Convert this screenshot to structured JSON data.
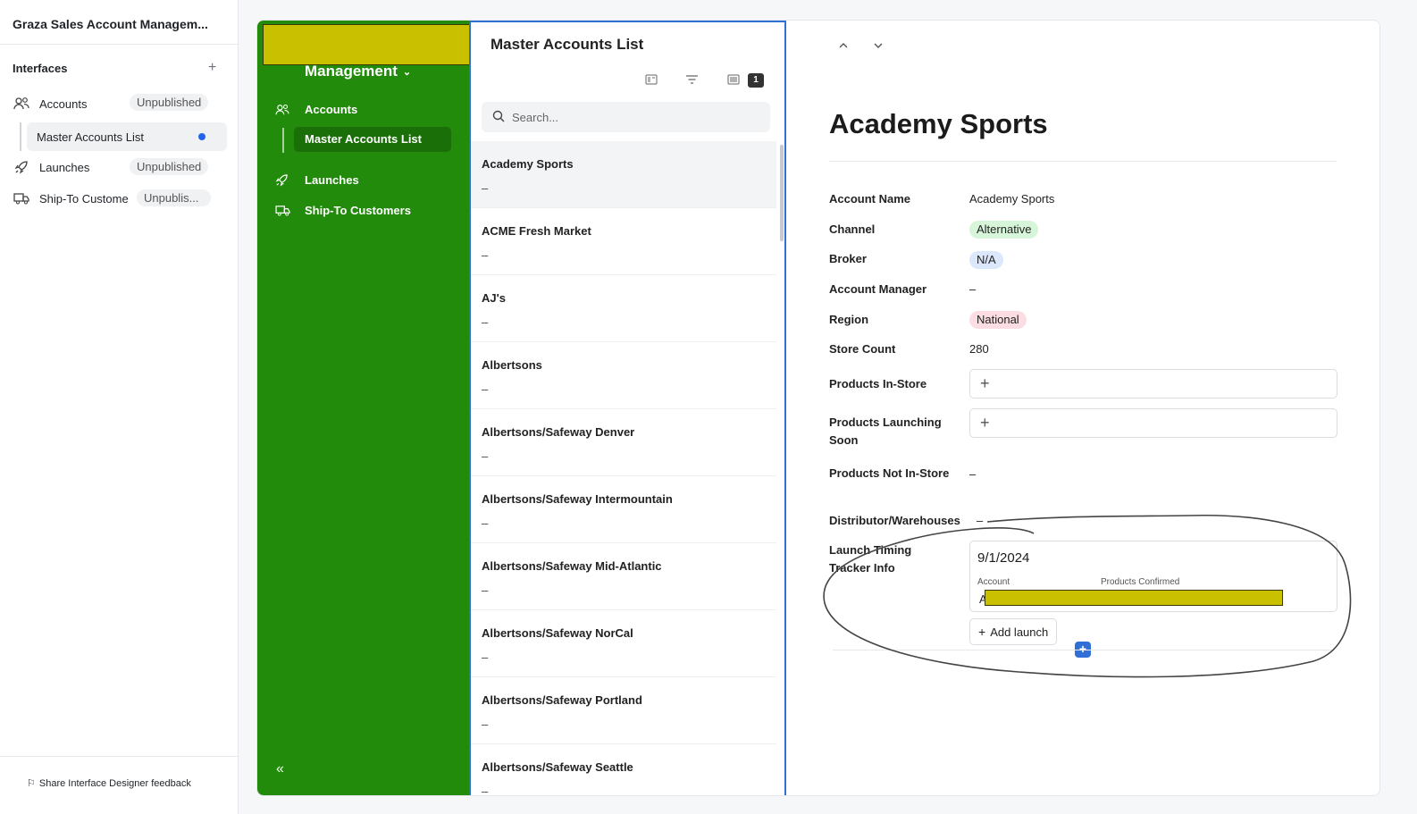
{
  "designer": {
    "base_title": "Graza Sales Account Managem...",
    "interfaces_label": "Interfaces",
    "items": [
      {
        "label": "Accounts",
        "status": "Unpublished"
      },
      {
        "label": "Launches",
        "status": "Unpublished"
      },
      {
        "label": "Ship-To Custome",
        "status": "Unpublis..."
      }
    ],
    "sub_page": "Master Accounts List",
    "feedback": "Share Interface Designer feedback"
  },
  "app_nav": {
    "title": "Management",
    "items": [
      {
        "label": "Accounts"
      },
      {
        "label": "Master Accounts List"
      },
      {
        "label": "Launches"
      },
      {
        "label": "Ship-To Customers"
      }
    ]
  },
  "list": {
    "title": "Master Accounts List",
    "filter_count": "1",
    "search_placeholder": "Search...",
    "rows": [
      {
        "name": "Academy Sports",
        "sub": "–"
      },
      {
        "name": "ACME Fresh Market",
        "sub": "–"
      },
      {
        "name": "AJ's",
        "sub": "–"
      },
      {
        "name": "Albertsons",
        "sub": "–"
      },
      {
        "name": "Albertsons/Safeway Denver",
        "sub": "–"
      },
      {
        "name": "Albertsons/Safeway Intermountain",
        "sub": "–"
      },
      {
        "name": "Albertsons/Safeway Mid-Atlantic",
        "sub": "–"
      },
      {
        "name": "Albertsons/Safeway NorCal",
        "sub": "–"
      },
      {
        "name": "Albertsons/Safeway Portland",
        "sub": "–"
      },
      {
        "name": "Albertsons/Safeway Seattle",
        "sub": "–"
      }
    ]
  },
  "detail": {
    "title": "Academy Sports",
    "fields": {
      "account_name": {
        "label": "Account Name",
        "value": "Academy Sports"
      },
      "channel": {
        "label": "Channel",
        "value": "Alternative"
      },
      "broker": {
        "label": "Broker",
        "value": "N/A"
      },
      "account_manager": {
        "label": "Account Manager",
        "value": "–"
      },
      "region": {
        "label": "Region",
        "value": "National"
      },
      "store_count": {
        "label": "Store Count",
        "value": "280"
      },
      "products_in_store": {
        "label": "Products In-Store"
      },
      "products_launching": {
        "label": "Products Launching Soon"
      },
      "products_not_in_store": {
        "label": "Products Not In-Store",
        "value": "–"
      },
      "distributor": {
        "label": "Distributor/Warehouses",
        "value": "–"
      },
      "launch_timing": {
        "label": "Launch Timing Tracker Info"
      }
    },
    "launch": {
      "date": "9/1/2024",
      "col_account": "Account",
      "col_products": "Products Confirmed",
      "account_value": "A"
    },
    "add_launch": "Add launch"
  },
  "colors": {
    "nav_green": "#228b0b",
    "accent_blue": "#2f6fd6",
    "channel_pill": "#d6f5d9",
    "broker_pill": "#dbe7fb",
    "region_pill": "#fbdde3",
    "redaction": "#c9c000"
  }
}
